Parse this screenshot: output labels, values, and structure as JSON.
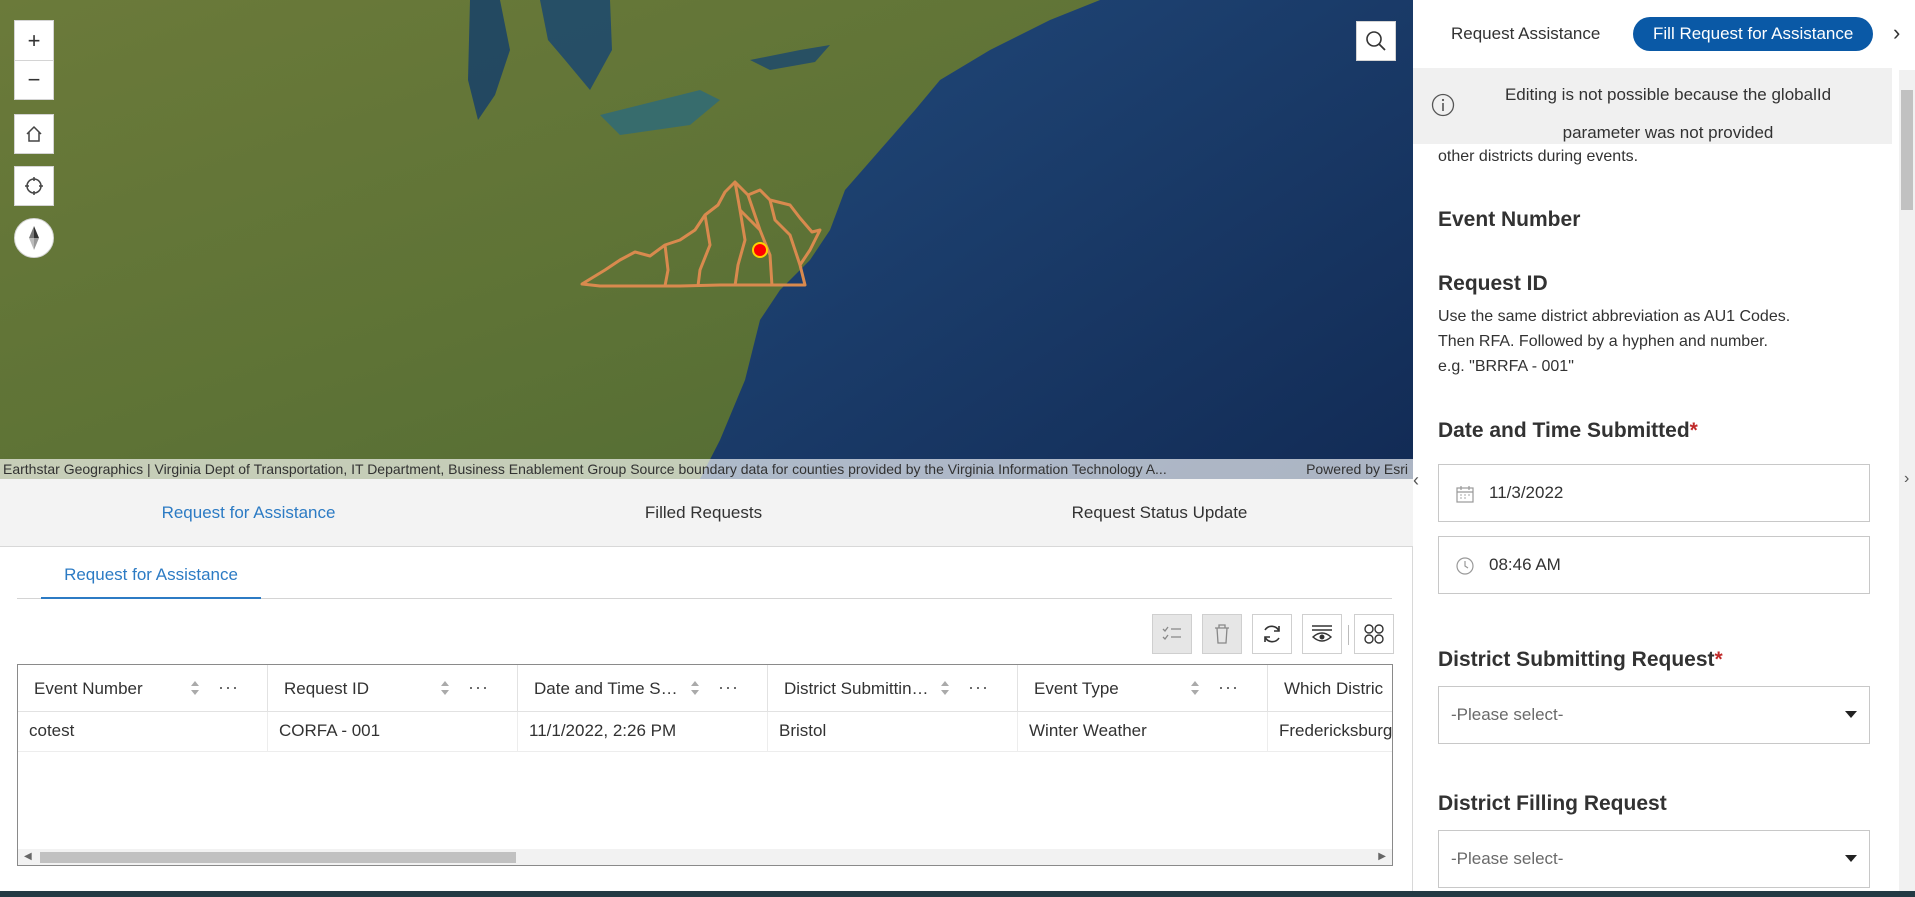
{
  "map": {
    "zoom_in": "+",
    "zoom_out": "−",
    "attribution": "Earthstar Geographics | Virginia Dept of Transportation, IT Department, Business Enablement Group Source boundary data for counties provided by the Virginia Information Technology A...",
    "powered_by": "Powered by Esri",
    "icons": [
      "zoom-in-icon",
      "zoom-out-icon",
      "home-icon",
      "locate-icon",
      "compass-icon",
      "search-icon"
    ]
  },
  "bottom_tabs": [
    {
      "label": "Request for Assistance",
      "active": true
    },
    {
      "label": "Filled Requests",
      "active": false
    },
    {
      "label": "Request Status Update",
      "active": false
    }
  ],
  "table": {
    "tab_label": "Request for Assistance",
    "columns": [
      "Event Number",
      "Request ID",
      "Date and Time Su...",
      "District Submitting...",
      "Event Type",
      "Which Distric"
    ],
    "rows": [
      [
        "cotest",
        "CORFA - 001",
        "11/1/2022, 2:26 PM",
        "Bristol",
        "Winter Weather",
        "Fredericksburg"
      ]
    ]
  },
  "side": {
    "tab_request": "Request Assistance",
    "tab_fill": "Fill Request for Assistance",
    "notice_line1": "Editing is not possible because the globalId",
    "notice_line2": "parameter was not provided",
    "cut_text": "other districts during events.",
    "event_number_label": "Event Number",
    "request_id_label": "Request ID",
    "request_id_help1": "Use the same district abbreviation as AU1 Codes.",
    "request_id_help2": "Then RFA. Followed by a hyphen and number.",
    "request_id_help3": "e.g. \"BRRFA - 001\"",
    "date_label": "Date and Time Submitted",
    "required_mark": "*",
    "date_value": "11/3/2022",
    "time_value": "08:46 AM",
    "district_submitting_label": "District Submitting Request",
    "district_submitting_value": "-Please select-",
    "district_filling_label": "District Filling Request",
    "district_filling_value": "-Please select-"
  },
  "colors": {
    "accent": "#2c7bc4",
    "primary_button": "#0a59a6",
    "boundary": "#d98a4e",
    "marker": "#ff0000"
  }
}
